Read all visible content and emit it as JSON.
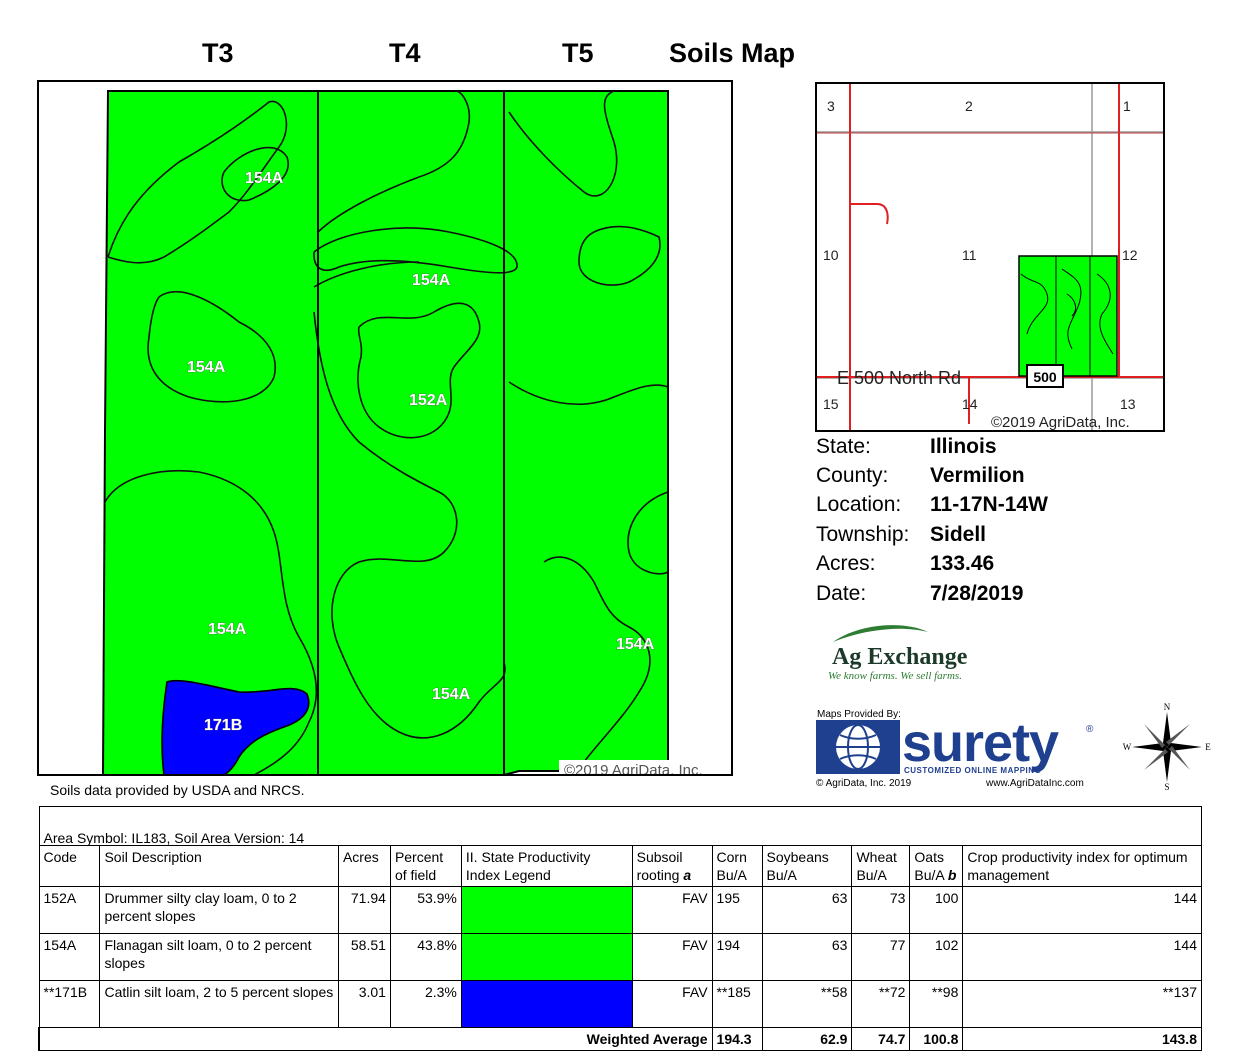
{
  "header": {
    "t3": "T3",
    "t4": "T4",
    "t5": "T5",
    "title": "Soils Map"
  },
  "main_map": {
    "copyright": "©2019 AgriData, Inc.",
    "labels": [
      "154A",
      "154A",
      "154A",
      "152A",
      "154A",
      "154A",
      "154A",
      "171B"
    ],
    "colors": {
      "green": "#00ff00",
      "blue": "#0000ff"
    }
  },
  "soil_source": "Soils data provided by USDA and NRCS.",
  "location_map": {
    "sections": [
      "3",
      "2",
      "1",
      "10",
      "11",
      "12",
      "15",
      "14",
      "13"
    ],
    "road": "E 500 North Rd",
    "route": "500",
    "copyright": "©2019 AgriData, Inc."
  },
  "info": {
    "state_label": "State:",
    "state": "Illinois",
    "county_label": "County:",
    "county": "Vermilion",
    "location_label": "Location:",
    "location": "11-17N-14W",
    "township_label": "Township:",
    "township": "Sidell",
    "acres_label": "Acres:",
    "acres": "133.46",
    "date_label": "Date:",
    "date": "7/28/2019"
  },
  "ag_exchange": {
    "name": "Ag Exchange",
    "tagline": "We know farms. We sell farms."
  },
  "surety": {
    "provided_by": "Maps Provided By:",
    "name": "surety",
    "registered": "®",
    "subtitle": "CUSTOMIZED ONLINE MAPPING",
    "copyright": "© AgriData, Inc. 2019",
    "website": "www.AgriDataInc.com"
  },
  "compass": {
    "n": "N",
    "e": "E",
    "s": "S",
    "w": "W"
  },
  "table": {
    "area_symbol": "Area Symbol: IL183, Soil Area Version: 14",
    "headers": {
      "code": "Code",
      "description": "Soil Description",
      "acres": "Acres",
      "percent": "Percent of field",
      "legend": "II. State Productivity Index Legend",
      "subsoil_a": "Subsoil rooting",
      "subsoil_b": "a",
      "corn": "Corn Bu/A",
      "soybeans": "Soybeans Bu/A",
      "wheat": "Wheat Bu/A",
      "oats_a": "Oats Bu/A",
      "oats_b": "b",
      "crop_index": "Crop productivity index for optimum management"
    },
    "rows": [
      {
        "code": "152A",
        "description": "Drummer silty clay loam, 0 to 2 percent slopes",
        "acres": "71.94",
        "percent": "53.9%",
        "color": "#00ff00",
        "subsoil": "FAV",
        "corn": "195",
        "soybeans": "63",
        "wheat": "73",
        "oats": "100",
        "index": "144"
      },
      {
        "code": "154A",
        "description": "Flanagan silt loam, 0 to 2 percent slopes",
        "acres": "58.51",
        "percent": "43.8%",
        "color": "#00ff00",
        "subsoil": "FAV",
        "corn": "194",
        "soybeans": "63",
        "wheat": "77",
        "oats": "102",
        "index": "144"
      },
      {
        "code": "**171B",
        "description": "Catlin silt loam, 2 to 5 percent slopes",
        "acres": "3.01",
        "percent": "2.3%",
        "color": "#0000ff",
        "subsoil": "FAV",
        "corn": "**185",
        "soybeans": "**58",
        "wheat": "**72",
        "oats": "**98",
        "index": "**137"
      }
    ],
    "weighted": {
      "label": "Weighted Average",
      "corn": "194.3",
      "soybeans": "62.9",
      "wheat": "74.7",
      "oats": "100.8",
      "index": "143.8"
    }
  }
}
